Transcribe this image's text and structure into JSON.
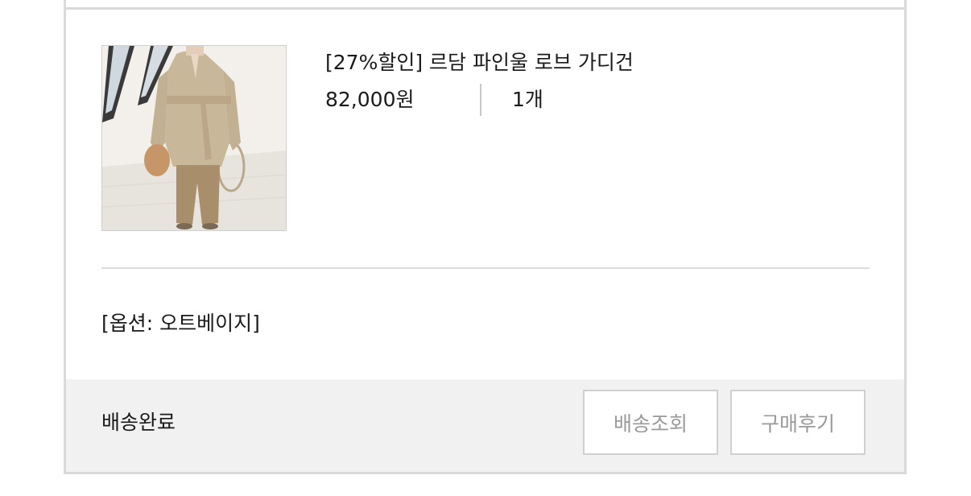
{
  "product": {
    "name": "[27%할인] 르담 파인울 로브 가디건",
    "price": "82,000원",
    "quantity": "1개",
    "option": "[옵션: 오트베이지]",
    "image_description": "model-wearing-beige-wrap-cardigan"
  },
  "order": {
    "status": "배송완료"
  },
  "actions": {
    "track_label": "배송조회",
    "review_label": "구매후기"
  },
  "colors": {
    "border": "#d9d9d9",
    "footer_bg": "#f1f1f1",
    "button_text": "#9a9a9a",
    "text": "#1a1a1a"
  }
}
